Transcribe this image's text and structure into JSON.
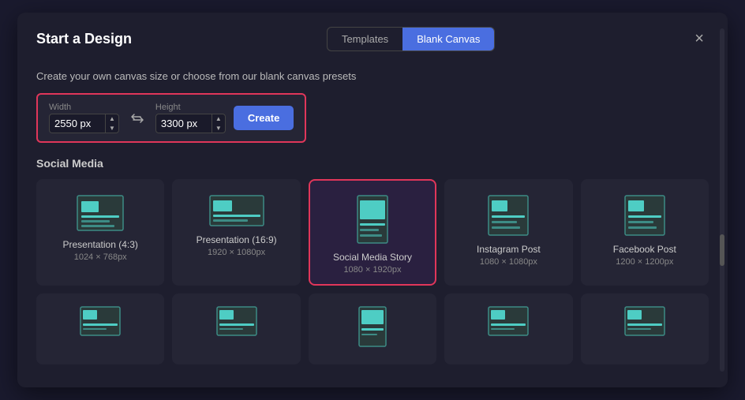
{
  "modal": {
    "title": "Start a Design",
    "close_label": "×"
  },
  "tabs": {
    "templates_label": "Templates",
    "blank_canvas_label": "Blank Canvas",
    "active": "blank_canvas"
  },
  "subtitle": "Create your own canvas size or choose from our blank canvas presets",
  "canvas_size": {
    "width_label": "Width",
    "height_label": "Height",
    "width_value": "2550 px",
    "height_value": "3300 px",
    "create_label": "Create"
  },
  "section_label": "Social Media",
  "presets": [
    {
      "name": "Presentation (4:3)",
      "size": "1024 × 768px",
      "shape": "landscape",
      "selected": false
    },
    {
      "name": "Presentation (16:9)",
      "size": "1920 × 1080px",
      "shape": "landscape-wide",
      "selected": false
    },
    {
      "name": "Social Media Story",
      "size": "1080 × 1920px",
      "shape": "portrait",
      "selected": true
    },
    {
      "name": "Instagram Post",
      "size": "1080 × 1080px",
      "shape": "square",
      "selected": false
    },
    {
      "name": "Facebook Post",
      "size": "1200 × 1200px",
      "shape": "square",
      "selected": false
    }
  ],
  "presets_row2": [
    {
      "name": "",
      "size": "",
      "shape": "landscape"
    },
    {
      "name": "",
      "size": "",
      "shape": "landscape"
    },
    {
      "name": "",
      "size": "",
      "shape": "portrait"
    },
    {
      "name": "",
      "size": "",
      "shape": "landscape"
    },
    {
      "name": "",
      "size": "",
      "shape": "landscape"
    }
  ]
}
